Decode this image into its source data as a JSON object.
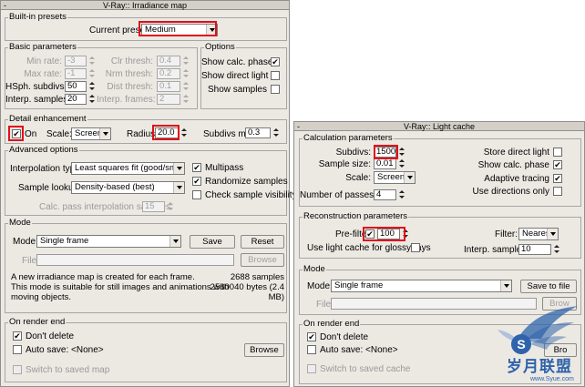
{
  "irr": {
    "title": "V-Ray:: Irradiance map",
    "minus": "-",
    "presets": {
      "group": "Built-in presets",
      "label": "Current preset:",
      "value": "Medium"
    },
    "basic": {
      "group": "Basic parameters",
      "min_rate": {
        "label": "Min rate:",
        "value": "-3"
      },
      "max_rate": {
        "label": "Max rate:",
        "value": "-1"
      },
      "hsph": {
        "label": "HSph. subdivs:",
        "value": "50"
      },
      "interp": {
        "label": "Interp. samples:",
        "value": "20"
      },
      "clr": {
        "label": "Clr thresh:",
        "value": "0.4"
      },
      "nrm": {
        "label": "Nrm thresh:",
        "value": "0.2"
      },
      "dist": {
        "label": "Dist thresh:",
        "value": "0.1"
      },
      "frames": {
        "label": "Interp. frames:",
        "value": "2"
      }
    },
    "options": {
      "group": "Options",
      "calc_phase": "Show calc. phase",
      "direct_light": "Show direct light",
      "samples": "Show samples"
    },
    "detail": {
      "group": "Detail enhancement",
      "on": "On",
      "scale_label": "Scale:",
      "scale": "Screen",
      "radius_label": "Radius:",
      "radius": "20.0",
      "subdivs_label": "Subdivs mult.",
      "subdivs": "0.3"
    },
    "advanced": {
      "group": "Advanced options",
      "interp_type_label": "Interpolation type:",
      "interp_type": "Least squares fit (good/smooth",
      "lookup_label": "Sample lookup:",
      "lookup": "Density-based (best)",
      "calc_pass_label": "Calc. pass interpolation samples:",
      "calc_pass": "15",
      "multipass": "Multipass",
      "randomize": "Randomize samples",
      "check_vis": "Check sample visibility"
    },
    "mode": {
      "group": "Mode",
      "label": "Mode:",
      "value": "Single frame",
      "save": "Save",
      "reset": "Reset",
      "file_label": "File:",
      "browse": "Browse",
      "desc1": "A new irradiance map is created for each frame.",
      "desc2": "This mode is suitable for still images and animations with",
      "desc3": "moving objects.",
      "samples": "2688 samples",
      "bytes": "2560040 bytes (2.4",
      "mb": "MB)"
    },
    "render_end": {
      "group": "On render end",
      "dont_delete": "Don't delete",
      "auto_save": "Auto save: <None>",
      "browse": "Browse",
      "switch": "Switch to saved map"
    }
  },
  "lc": {
    "title": "V-Ray:: Light cache",
    "minus": "-",
    "calc": {
      "group": "Calculation parameters",
      "subdivs_label": "Subdivs:",
      "subdivs": "1500",
      "sample_size_label": "Sample size:",
      "sample_size": "0.01",
      "scale_label": "Scale:",
      "scale": "Screen",
      "passes_label": "Number of passes:",
      "passes": "4",
      "store_direct": "Store direct light",
      "show_calc": "Show calc. phase",
      "adaptive": "Adaptive tracing",
      "use_dirs": "Use directions only"
    },
    "recon": {
      "group": "Reconstruction parameters",
      "prefilter_label": "Pre-filter:",
      "prefilter": "100",
      "glossy": "Use light cache for glossy rays",
      "filter_label": "Filter:",
      "filter": "Nearest",
      "interp_label": "Interp. samples:",
      "interp": "10"
    },
    "mode": {
      "group": "Mode",
      "label": "Mode:",
      "value": "Single frame",
      "save_file": "Save to file",
      "file_label": "File:",
      "browse": "Brow"
    },
    "render_end": {
      "group": "On render end",
      "dont_delete": "Don't delete",
      "auto_save": "Auto save: <None>",
      "browse": "Bro",
      "switch": "Switch to saved cache"
    }
  },
  "watermark": {
    "text": "岁月联盟",
    "url": "www.Syue.com",
    "letter": "S",
    "colors": {
      "blue": "#2f63ab",
      "light": "#9fb8da"
    }
  }
}
